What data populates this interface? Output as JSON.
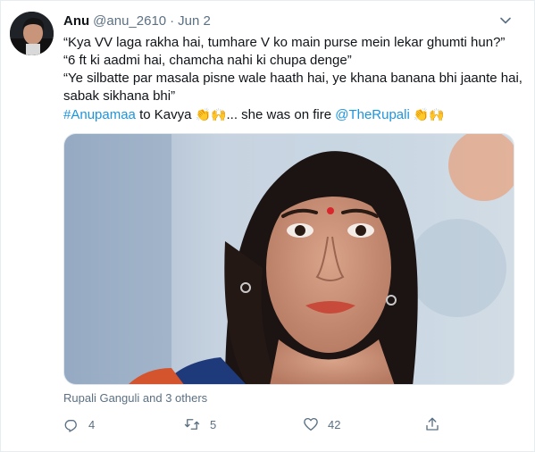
{
  "tweet": {
    "author_name": "Anu",
    "author_handle": "@anu_2610",
    "separator": "·",
    "date": "Jun 2",
    "lines": [
      "“Kya VV laga rakha hai, tumhare V ko main purse mein lekar ghumti hun?”",
      "“6 ft ki aadmi hai, chamcha nahi ki chupa denge”",
      "“Ye silbatte par masala pisne wale haath hai, ye khana banana bhi jaante hai, sabak sikhana bhi”"
    ],
    "last_line": {
      "hashtag": "#Anupamaa",
      "text_after_hashtag": " to Kavya ",
      "emoji_1": "👏🙌",
      "text_middle": "... she was on fire ",
      "mention": "@TheRupali",
      "emoji_2": " 👏🙌"
    },
    "liked_by": "Rupali Ganguli and 3 others",
    "reply_count": "4",
    "retweet_count": "5",
    "like_count": "42"
  },
  "icons": {
    "more": "chevron-down-icon",
    "reply": "reply-icon",
    "retweet": "retweet-icon",
    "like": "heart-icon",
    "share": "share-icon"
  },
  "colors": {
    "link": "#1b95e0",
    "secondary_text": "#5b7083",
    "primary_text": "#0f1419"
  }
}
